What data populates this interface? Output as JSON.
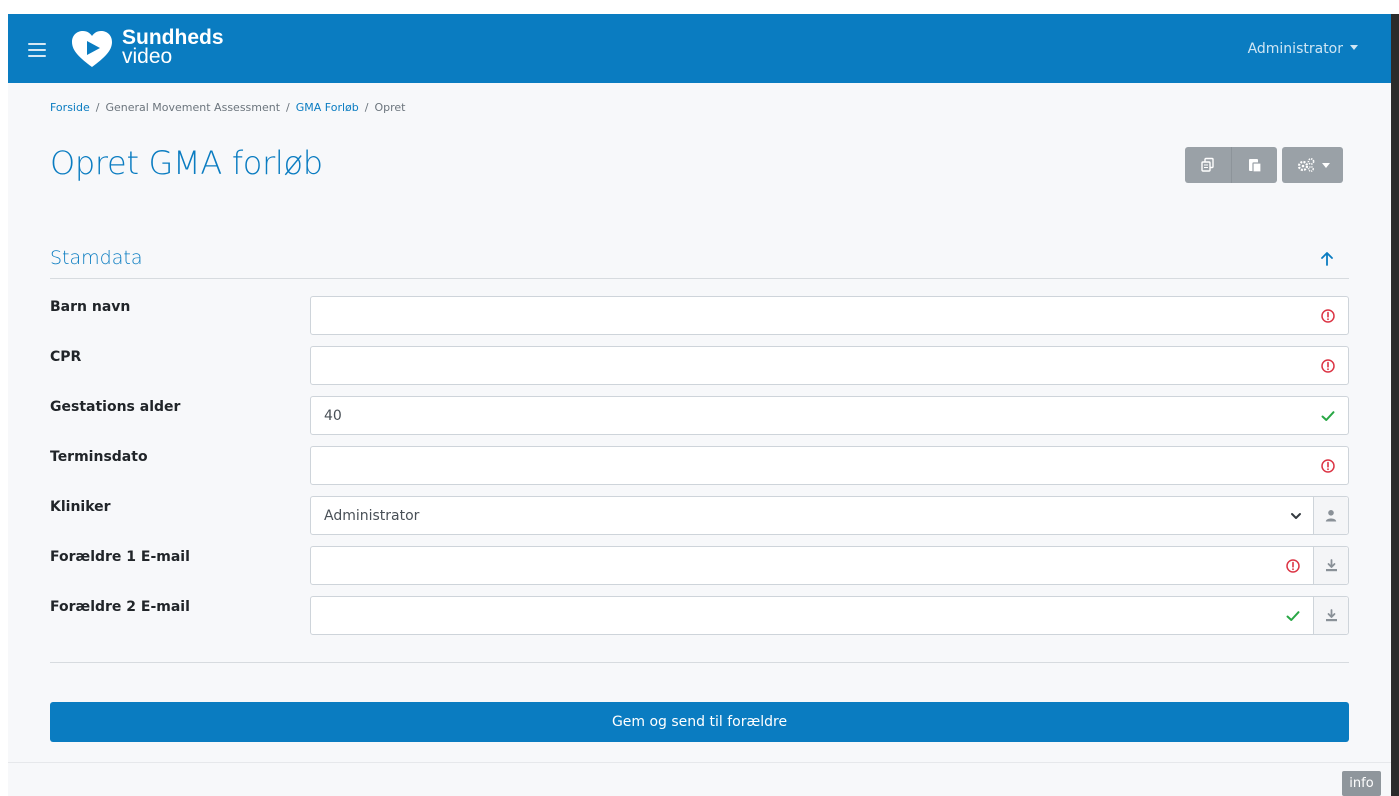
{
  "header": {
    "logo": {
      "line1": "Sundheds",
      "line2": "video"
    },
    "user_menu": "Administrator"
  },
  "breadcrumb": [
    {
      "label": "Forside",
      "link": true
    },
    {
      "label": "General Movement Assessment",
      "link": false
    },
    {
      "label": "GMA Forløb",
      "link": true
    },
    {
      "label": "Opret",
      "link": false
    }
  ],
  "breadcrumb_sep": "/",
  "page": {
    "title": "Opret GMA forløb"
  },
  "toolbar": {
    "buttons": [
      {
        "icon": "copy-icon"
      },
      {
        "icon": "paste-icon"
      },
      {
        "icon": "cogs-icon",
        "dropdown": true
      }
    ]
  },
  "section": {
    "title": "Stamdata"
  },
  "form": {
    "fields": [
      {
        "label": "Barn navn",
        "value": "",
        "status": "invalid"
      },
      {
        "label": "CPR",
        "value": "",
        "status": "invalid"
      },
      {
        "label": "Gestations alder",
        "value": "40",
        "status": "valid"
      },
      {
        "label": "Terminsdato",
        "value": "",
        "status": "invalid"
      },
      {
        "label": "Kliniker",
        "value": "Administrator",
        "type": "select",
        "addon_icon": "user-icon"
      },
      {
        "label": "Forældre 1 E-mail",
        "value": "",
        "status": "invalid",
        "addon_icon": "download-icon"
      },
      {
        "label": "Forældre 2 E-mail",
        "value": "",
        "status": "valid",
        "addon_icon": "download-icon"
      }
    ]
  },
  "submit_label": "Gem og send til forældre",
  "info_badge": "info",
  "colors": {
    "primary": "#0a7cc1",
    "invalid": "#dc3545",
    "valid": "#28a745",
    "toolbar_gray": "#9aa1a7"
  }
}
